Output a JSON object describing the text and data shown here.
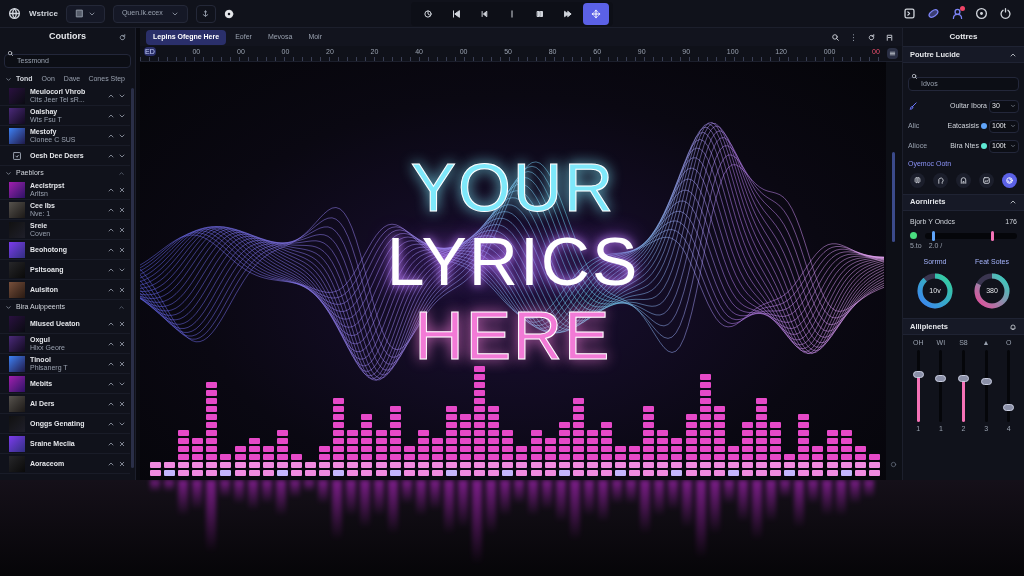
{
  "toolbar": {
    "app_name": "Wstrice",
    "preset_select": "Quen.lk.ecex"
  },
  "transport": [
    {
      "kind": "loop",
      "selected": false
    },
    {
      "kind": "skip-back",
      "selected": false
    },
    {
      "kind": "step-back",
      "selected": false
    },
    {
      "kind": "bar",
      "selected": false
    },
    {
      "kind": "pause",
      "selected": false
    },
    {
      "kind": "forward",
      "selected": false
    },
    {
      "kind": "move",
      "selected": true
    }
  ],
  "top_icons": [
    {
      "kind": "terminal",
      "badge": false
    },
    {
      "kind": "link",
      "badge": false
    },
    {
      "kind": "user",
      "badge": true
    },
    {
      "kind": "target",
      "badge": false
    },
    {
      "kind": "power",
      "badge": false
    }
  ],
  "sidebar": {
    "title": "Coutiors",
    "search": {
      "placeholder": "Tessmond"
    },
    "sections": [
      {
        "title": "Tond",
        "columns": [
          "Oon",
          "Dave",
          "Cones Step"
        ],
        "expanded": true,
        "items": [
          {
            "name": "Meulocorl Vhrob",
            "subtitle": "Cits Jeer Tei sR...",
            "kind": "thumb",
            "removable": false
          },
          {
            "name": "Oalshay",
            "subtitle": "Wts Fsu T",
            "kind": "thumb",
            "removable": false
          },
          {
            "name": "Mestofy",
            "subtitle": "Cionee C SUS",
            "kind": "thumb",
            "removable": false
          },
          {
            "name": "Oesh Dee Deers",
            "kind": "icon",
            "removable": false
          }
        ]
      },
      {
        "title": "Paeblors",
        "expanded": true,
        "items": [
          {
            "name": "Aeclstrpst",
            "subtitle": "Arltsn",
            "kind": "thumb",
            "removable": true
          },
          {
            "name": "Cee Ibs",
            "subtitle": "Nve: 1",
            "kind": "thumb",
            "removable": true
          },
          {
            "name": "Sreie",
            "subtitle": "Coven",
            "kind": "thumb",
            "removable": true
          },
          {
            "name": "Beohotong",
            "kind": "thumb",
            "removable": true
          },
          {
            "name": "Psltsoang",
            "kind": "thumb",
            "removable": false
          },
          {
            "name": "Aulsiton",
            "kind": "thumb",
            "removable": true
          }
        ]
      },
      {
        "title": "Bira Aulppeents",
        "expanded": true,
        "items": [
          {
            "name": "Mlused Ueaton",
            "kind": "thumb",
            "removable": true
          },
          {
            "name": "Oxgul",
            "subtitle": "Hlxx Geore",
            "kind": "thumb",
            "removable": true
          },
          {
            "name": "Tinool",
            "subtitle": "Phlsanerg T",
            "kind": "thumb",
            "removable": true
          },
          {
            "name": "Mebits",
            "kind": "thumb",
            "removable": false
          },
          {
            "name": "Al Ders",
            "kind": "thumb",
            "removable": true
          },
          {
            "name": "Onggs Genating",
            "kind": "thumb",
            "removable": false
          },
          {
            "name": "Sraine Meclia",
            "kind": "thumb",
            "removable": true
          },
          {
            "name": "Aoraceom",
            "kind": "thumb",
            "removable": true
          }
        ]
      }
    ]
  },
  "editor": {
    "tabs": [
      {
        "label": "Lepins Ofegne Here",
        "selected": true
      },
      {
        "label": "Eofer",
        "selected": false
      },
      {
        "label": "Mevosa",
        "selected": false
      },
      {
        "label": "Moir",
        "selected": false
      }
    ],
    "ruler": [
      {
        "text": "ED",
        "kind": "start"
      },
      {
        "text": "00",
        "kind": "tick"
      },
      {
        "text": "00",
        "kind": "tick"
      },
      {
        "text": "00",
        "kind": "tick"
      },
      {
        "text": "20",
        "kind": "tick"
      },
      {
        "text": "20",
        "kind": "tick"
      },
      {
        "text": "40",
        "kind": "tick"
      },
      {
        "text": "00",
        "kind": "tick"
      },
      {
        "text": "50",
        "kind": "tick"
      },
      {
        "text": "80",
        "kind": "tick"
      },
      {
        "text": "60",
        "kind": "tick"
      },
      {
        "text": "90",
        "kind": "tick"
      },
      {
        "text": "90",
        "kind": "tick"
      },
      {
        "text": "100",
        "kind": "tick"
      },
      {
        "text": "120",
        "kind": "tick"
      },
      {
        "text": "000",
        "kind": "tick"
      },
      {
        "text": "00",
        "kind": "end"
      }
    ],
    "lyrics": [
      {
        "text": "YOUR",
        "kind": "outline",
        "color": "#7ee8fa"
      },
      {
        "text": "LYRICS",
        "kind": "filled",
        "color": "#ffffff"
      },
      {
        "text": "HERE",
        "kind": "outline",
        "color": "#f27ad6"
      }
    ]
  },
  "properties": {
    "panel_title": "Cottres",
    "title": "Poutre Lucide",
    "expanded": true,
    "search": {
      "placeholder": "Idvos"
    },
    "rows": [
      {
        "kind": "icon",
        "label": "Oultar Ibora",
        "value": "30"
      },
      {
        "kind": "dot",
        "prefix": "Alic",
        "label": "Eatcasisis",
        "color": "#60a5fa",
        "value": "100t"
      },
      {
        "kind": "dot",
        "prefix": "Alioce",
        "label": "Bira Ntes",
        "color": "#5eead4",
        "value": "100t"
      }
    ],
    "style_title": "Oyemoc Ootn",
    "style_buttons": [
      {
        "kind": "brain",
        "selected": false
      },
      {
        "kind": "face",
        "selected": false
      },
      {
        "kind": "arch",
        "selected": false
      },
      {
        "kind": "frame",
        "selected": false
      },
      {
        "kind": "swirl",
        "selected": true
      }
    ]
  },
  "adjustments": {
    "title": "Aorniriets",
    "expanded": true,
    "label": "Bjorb Y Ondcs",
    "reading": "176",
    "toggle": {
      "on": true
    },
    "thumbs": [
      {
        "level": 0.08,
        "color": "#60a5fa"
      },
      {
        "level": 0.72,
        "color": "#f472b6"
      }
    ],
    "scale_labels": [
      "5.to",
      "2.0 /"
    ],
    "donuts": [
      {
        "label": "Sorrmd",
        "value": "10v",
        "level": 0.88
      },
      {
        "label": "Feat Sotes",
        "value": "380",
        "level": 0.82
      }
    ]
  },
  "mixer": {
    "title": "Alliplenets",
    "faders": [
      {
        "label": "OH",
        "number": "1",
        "level": 0.65,
        "active": true
      },
      {
        "label": "WI",
        "number": "1",
        "level": 0.6,
        "active": false
      },
      {
        "label": "S8",
        "number": "2",
        "level": 0.6,
        "active": true
      },
      {
        "label": "▲",
        "number": "3",
        "level": 0.55,
        "active": false
      },
      {
        "label": "O",
        "number": "4",
        "level": 0.2,
        "active": false
      }
    ]
  }
}
